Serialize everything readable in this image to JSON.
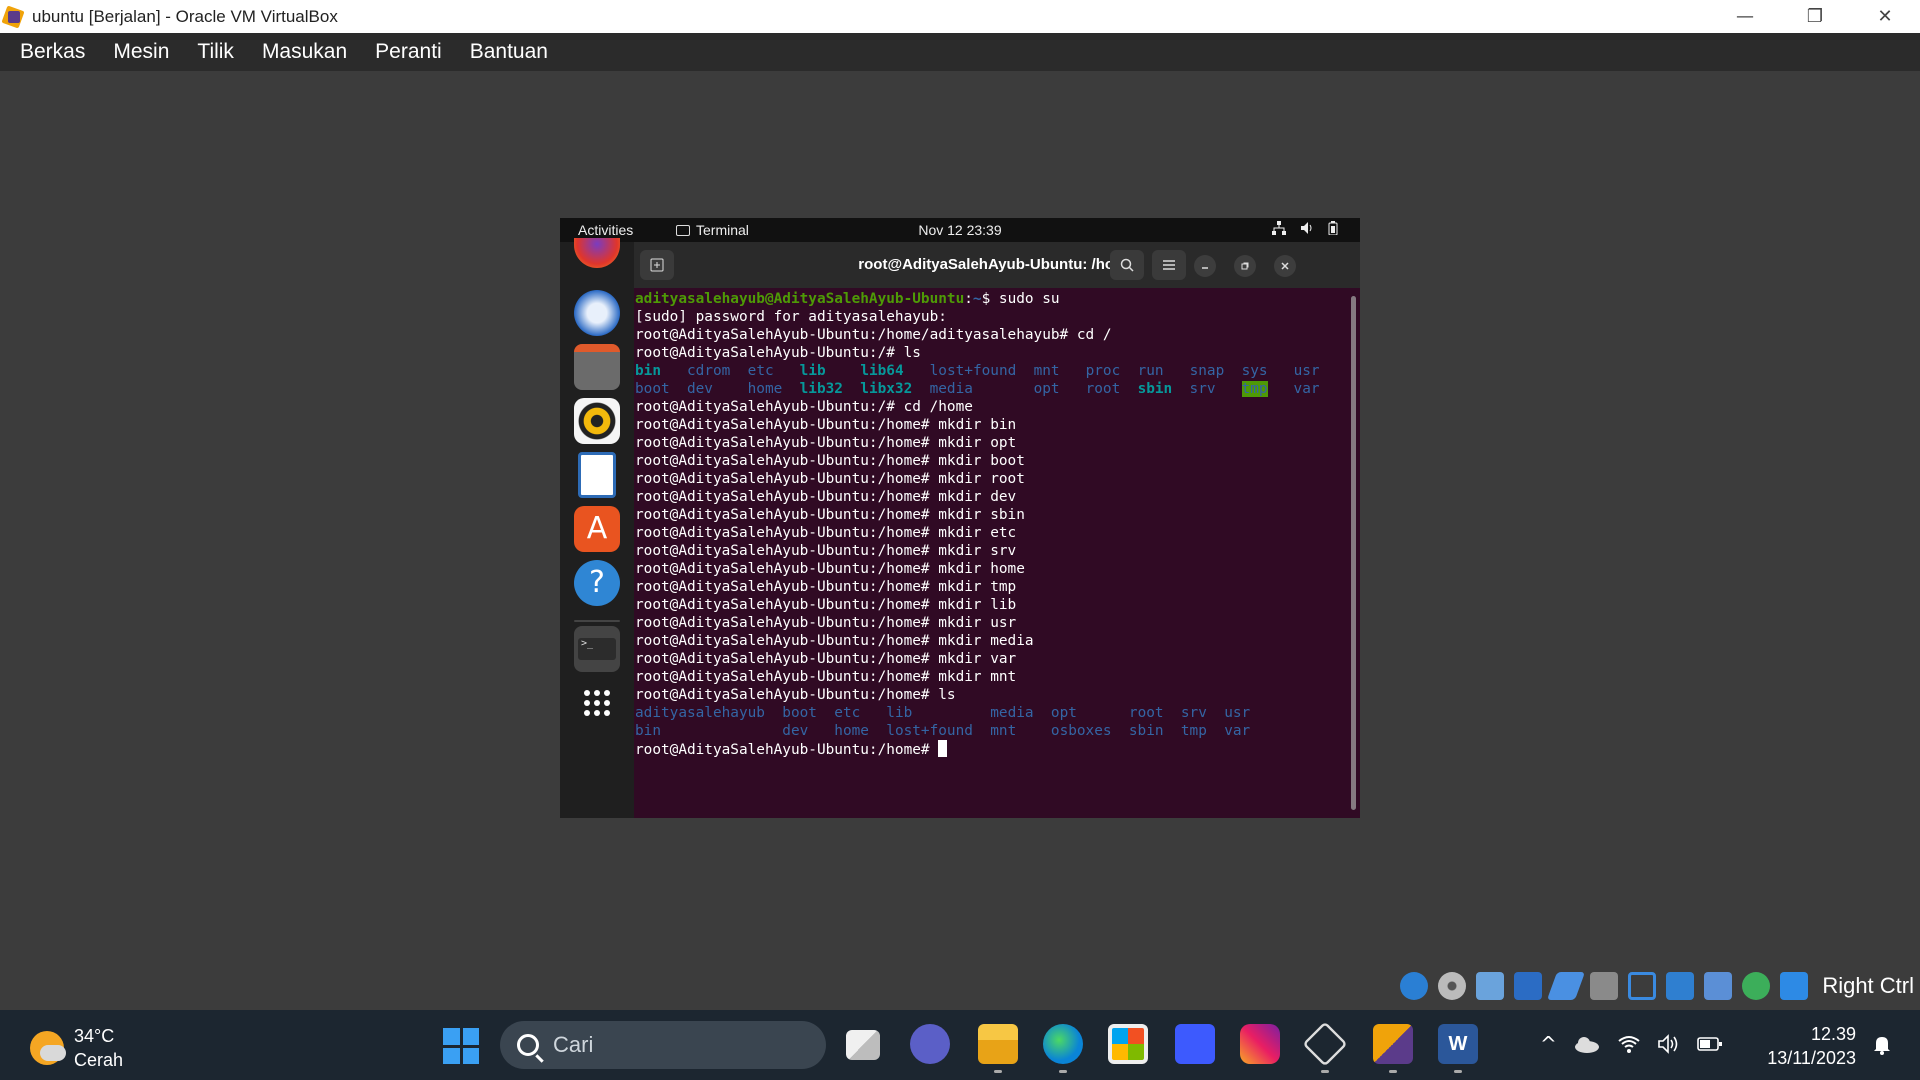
{
  "window": {
    "title": "ubuntu [Berjalan] - Oracle VM VirtualBox",
    "minimize": "—",
    "restore": "❐",
    "close": "✕"
  },
  "menubar": {
    "items": [
      "Berkas",
      "Mesin",
      "Tilik",
      "Masukan",
      "Peranti",
      "Bantuan"
    ]
  },
  "gnome": {
    "activities": "Activities",
    "app_name": "Terminal",
    "clock": "Nov 12  23:39"
  },
  "terminal": {
    "title": "root@AdityaSalehAyub-Ubuntu: /home",
    "lines": [
      [
        {
          "t": "adityasalehayub@AdityaSalehAyub-Ubuntu",
          "c": "c-green"
        },
        {
          "t": ":",
          "c": ""
        },
        {
          "t": "~",
          "c": "c-blue-b"
        },
        {
          "t": "$ sudo su",
          "c": ""
        }
      ],
      [
        {
          "t": "[sudo] password for adityasalehayub:",
          "c": ""
        }
      ],
      [
        {
          "t": "root@AdityaSalehAyub-Ubuntu:/home/adityasalehayub# cd /",
          "c": ""
        }
      ],
      [
        {
          "t": "root@AdityaSalehAyub-Ubuntu:/# ls",
          "c": ""
        }
      ],
      [
        {
          "t": "bin",
          "c": "c-cyan"
        },
        {
          "t": "   ",
          "c": ""
        },
        {
          "t": "cdrom",
          "c": "c-blue"
        },
        {
          "t": "  ",
          "c": ""
        },
        {
          "t": "etc",
          "c": "c-blue"
        },
        {
          "t": "   ",
          "c": ""
        },
        {
          "t": "lib",
          "c": "c-cyan"
        },
        {
          "t": "    ",
          "c": ""
        },
        {
          "t": "lib64",
          "c": "c-cyan"
        },
        {
          "t": "   ",
          "c": ""
        },
        {
          "t": "lost+found",
          "c": "c-blue"
        },
        {
          "t": "  ",
          "c": ""
        },
        {
          "t": "mnt",
          "c": "c-blue"
        },
        {
          "t": "   ",
          "c": ""
        },
        {
          "t": "proc",
          "c": "c-blue"
        },
        {
          "t": "  ",
          "c": ""
        },
        {
          "t": "run",
          "c": "c-blue"
        },
        {
          "t": "   ",
          "c": ""
        },
        {
          "t": "snap",
          "c": "c-blue"
        },
        {
          "t": "  ",
          "c": ""
        },
        {
          "t": "sys",
          "c": "c-blue"
        },
        {
          "t": "   ",
          "c": ""
        },
        {
          "t": "usr",
          "c": "c-blue"
        }
      ],
      [
        {
          "t": "boot",
          "c": "c-blue"
        },
        {
          "t": "  ",
          "c": ""
        },
        {
          "t": "dev",
          "c": "c-blue"
        },
        {
          "t": "    ",
          "c": ""
        },
        {
          "t": "home",
          "c": "c-blue"
        },
        {
          "t": "  ",
          "c": ""
        },
        {
          "t": "lib32",
          "c": "c-cyan"
        },
        {
          "t": "  ",
          "c": ""
        },
        {
          "t": "libx32",
          "c": "c-cyan"
        },
        {
          "t": "  ",
          "c": ""
        },
        {
          "t": "media",
          "c": "c-blue"
        },
        {
          "t": "       ",
          "c": ""
        },
        {
          "t": "opt",
          "c": "c-blue"
        },
        {
          "t": "   ",
          "c": ""
        },
        {
          "t": "root",
          "c": "c-blue"
        },
        {
          "t": "  ",
          "c": ""
        },
        {
          "t": "sbin",
          "c": "c-cyan"
        },
        {
          "t": "  ",
          "c": ""
        },
        {
          "t": "srv",
          "c": "c-blue"
        },
        {
          "t": "   ",
          "c": ""
        },
        {
          "t": "tmp",
          "c": "c-tmp"
        },
        {
          "t": "   ",
          "c": ""
        },
        {
          "t": "var",
          "c": "c-blue"
        }
      ],
      [
        {
          "t": "root@AdityaSalehAyub-Ubuntu:/# cd /home",
          "c": ""
        }
      ],
      [
        {
          "t": "root@AdityaSalehAyub-Ubuntu:/home# mkdir bin",
          "c": ""
        }
      ],
      [
        {
          "t": "root@AdityaSalehAyub-Ubuntu:/home# mkdir opt",
          "c": ""
        }
      ],
      [
        {
          "t": "root@AdityaSalehAyub-Ubuntu:/home# mkdir boot",
          "c": ""
        }
      ],
      [
        {
          "t": "root@AdityaSalehAyub-Ubuntu:/home# mkdir root",
          "c": ""
        }
      ],
      [
        {
          "t": "root@AdityaSalehAyub-Ubuntu:/home# mkdir dev",
          "c": ""
        }
      ],
      [
        {
          "t": "root@AdityaSalehAyub-Ubuntu:/home# mkdir sbin",
          "c": ""
        }
      ],
      [
        {
          "t": "root@AdityaSalehAyub-Ubuntu:/home# mkdir etc",
          "c": ""
        }
      ],
      [
        {
          "t": "root@AdityaSalehAyub-Ubuntu:/home# mkdir srv",
          "c": ""
        }
      ],
      [
        {
          "t": "root@AdityaSalehAyub-Ubuntu:/home# mkdir home",
          "c": ""
        }
      ],
      [
        {
          "t": "root@AdityaSalehAyub-Ubuntu:/home# mkdir tmp",
          "c": ""
        }
      ],
      [
        {
          "t": "root@AdityaSalehAyub-Ubuntu:/home# mkdir lib",
          "c": ""
        }
      ],
      [
        {
          "t": "root@AdityaSalehAyub-Ubuntu:/home# mkdir usr",
          "c": ""
        }
      ],
      [
        {
          "t": "root@AdityaSalehAyub-Ubuntu:/home# mkdir media",
          "c": ""
        }
      ],
      [
        {
          "t": "root@AdityaSalehAyub-Ubuntu:/home# mkdir var",
          "c": ""
        }
      ],
      [
        {
          "t": "root@AdityaSalehAyub-Ubuntu:/home# mkdir mnt",
          "c": ""
        }
      ],
      [
        {
          "t": "root@AdityaSalehAyub-Ubuntu:/home# ls",
          "c": ""
        }
      ],
      [
        {
          "t": "adityasalehayub",
          "c": "c-blue"
        },
        {
          "t": "  ",
          "c": ""
        },
        {
          "t": "boot",
          "c": "c-blue"
        },
        {
          "t": "  ",
          "c": ""
        },
        {
          "t": "etc",
          "c": "c-blue"
        },
        {
          "t": "   ",
          "c": ""
        },
        {
          "t": "lib",
          "c": "c-blue"
        },
        {
          "t": "         ",
          "c": ""
        },
        {
          "t": "media",
          "c": "c-blue"
        },
        {
          "t": "  ",
          "c": ""
        },
        {
          "t": "opt",
          "c": "c-blue"
        },
        {
          "t": "      ",
          "c": ""
        },
        {
          "t": "root",
          "c": "c-blue"
        },
        {
          "t": "  ",
          "c": ""
        },
        {
          "t": "srv",
          "c": "c-blue"
        },
        {
          "t": "  ",
          "c": ""
        },
        {
          "t": "usr",
          "c": "c-blue"
        }
      ],
      [
        {
          "t": "bin",
          "c": "c-blue"
        },
        {
          "t": "              ",
          "c": ""
        },
        {
          "t": "dev",
          "c": "c-blue"
        },
        {
          "t": "   ",
          "c": ""
        },
        {
          "t": "home",
          "c": "c-blue"
        },
        {
          "t": "  ",
          "c": ""
        },
        {
          "t": "lost+found",
          "c": "c-blue"
        },
        {
          "t": "  ",
          "c": ""
        },
        {
          "t": "mnt",
          "c": "c-blue"
        },
        {
          "t": "    ",
          "c": ""
        },
        {
          "t": "osboxes",
          "c": "c-blue"
        },
        {
          "t": "  ",
          "c": ""
        },
        {
          "t": "sbin",
          "c": "c-blue"
        },
        {
          "t": "  ",
          "c": ""
        },
        {
          "t": "tmp",
          "c": "c-blue"
        },
        {
          "t": "  ",
          "c": ""
        },
        {
          "t": "var",
          "c": "c-blue"
        }
      ],
      [
        {
          "t": "root@AdityaSalehAyub-Ubuntu:/home# ",
          "c": ""
        }
      ]
    ]
  },
  "status_bar": {
    "host_key": "Right Ctrl"
  },
  "taskbar": {
    "weather_temp": "34°C",
    "weather_desc": "Cerah",
    "search_placeholder": "Cari",
    "clock_time": "12.39",
    "clock_date": "13/11/2023",
    "tray_chevron": "^"
  },
  "colors": {
    "terminal_bg": "#300a24",
    "prompt_green": "#4e9a06",
    "dir_blue": "#3465a4",
    "taskbar_bg": "#1c2630"
  }
}
